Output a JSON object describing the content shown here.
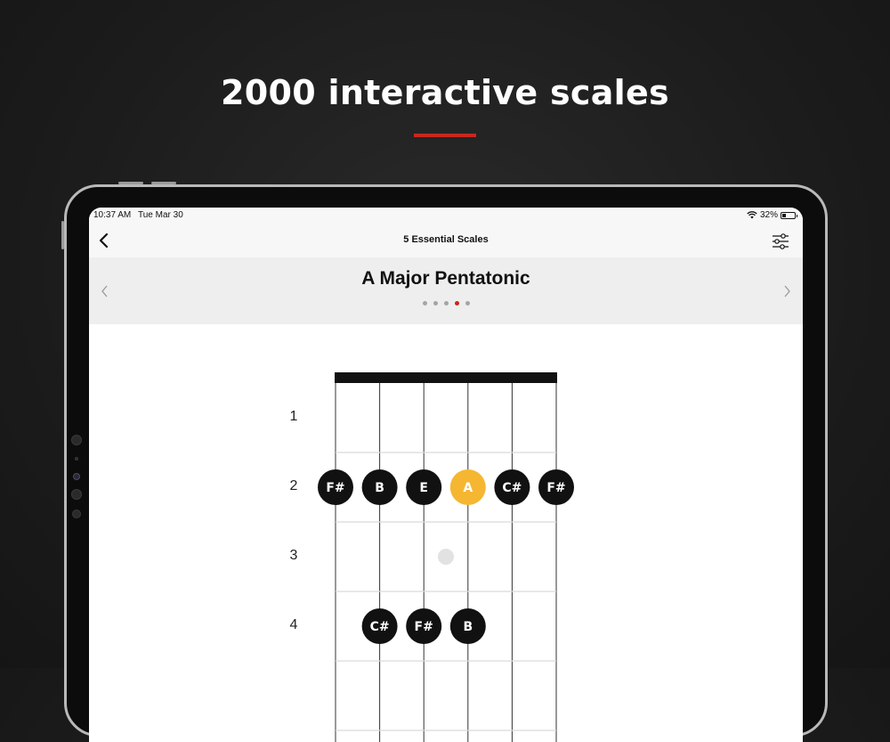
{
  "headline": "2000 interactive scales",
  "status_bar": {
    "time": "10:37 AM",
    "date": "Tue Mar 30",
    "battery": "32%",
    "battery_level": 0.32
  },
  "nav": {
    "title": "5 Essential Scales",
    "back_icon": "chevron-left-icon",
    "settings_icon": "sliders-icon"
  },
  "scale": {
    "title": "A Major Pentatonic",
    "page_count": 5,
    "active_page": 4
  },
  "colors": {
    "accent": "#c8281e",
    "root_note": "#f5b731",
    "note": "#111111"
  },
  "fretboard": {
    "fret_numbers": [
      "1",
      "2",
      "3",
      "4"
    ],
    "string_count": 6,
    "marker_fret": 3,
    "notes": [
      {
        "fret": 2,
        "string": 1,
        "label": "F#",
        "root": false
      },
      {
        "fret": 2,
        "string": 2,
        "label": "B",
        "root": false
      },
      {
        "fret": 2,
        "string": 3,
        "label": "E",
        "root": false
      },
      {
        "fret": 2,
        "string": 4,
        "label": "A",
        "root": true
      },
      {
        "fret": 2,
        "string": 5,
        "label": "C#",
        "root": false
      },
      {
        "fret": 2,
        "string": 6,
        "label": "F#",
        "root": false
      },
      {
        "fret": 4,
        "string": 2,
        "label": "C#",
        "root": false
      },
      {
        "fret": 4,
        "string": 3,
        "label": "F#",
        "root": false
      },
      {
        "fret": 4,
        "string": 4,
        "label": "B",
        "root": false
      }
    ]
  }
}
